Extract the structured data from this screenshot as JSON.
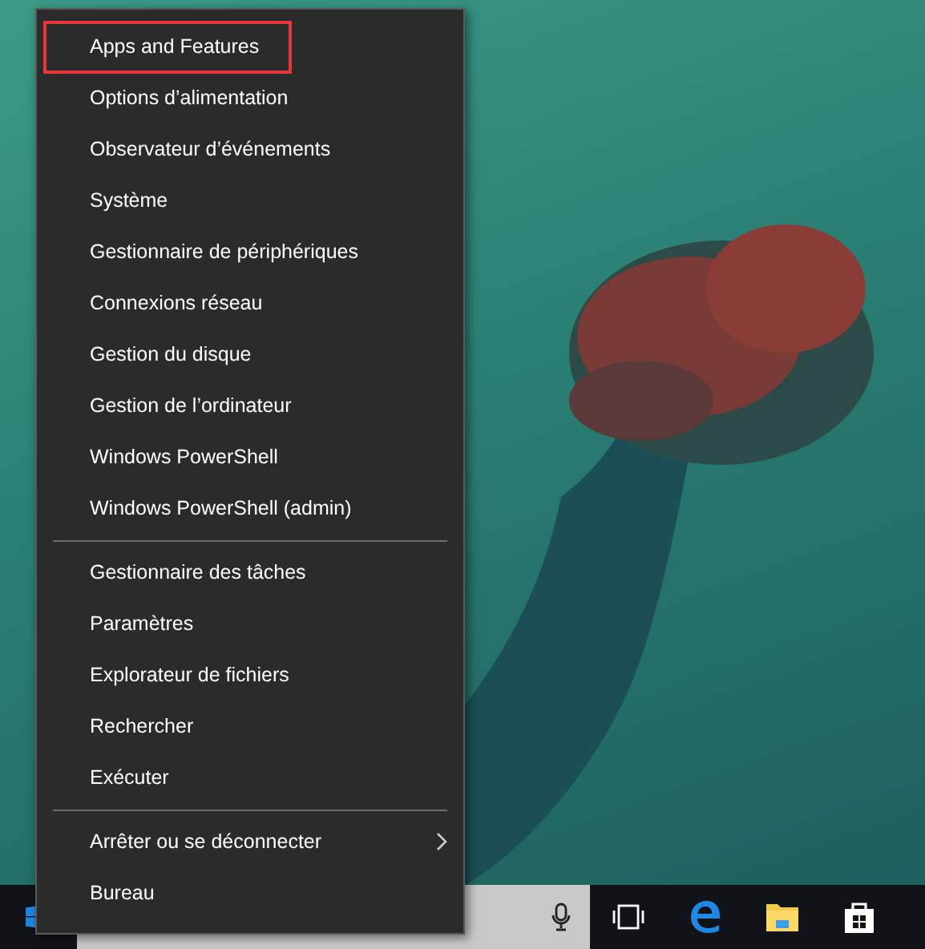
{
  "menu": {
    "groups": [
      {
        "items": [
          {
            "label": "Apps and Features",
            "highlighted": true,
            "submenu": false
          },
          {
            "label": "Options d’alimentation",
            "highlighted": false,
            "submenu": false
          },
          {
            "label": "Observateur d’événements",
            "highlighted": false,
            "submenu": false
          },
          {
            "label": "Système",
            "highlighted": false,
            "submenu": false
          },
          {
            "label": "Gestionnaire de périphériques",
            "highlighted": false,
            "submenu": false
          },
          {
            "label": "Connexions réseau",
            "highlighted": false,
            "submenu": false
          },
          {
            "label": "Gestion du disque",
            "highlighted": false,
            "submenu": false
          },
          {
            "label": "Gestion de l’ordinateur",
            "highlighted": false,
            "submenu": false
          },
          {
            "label": "Windows PowerShell",
            "highlighted": false,
            "submenu": false
          },
          {
            "label": "Windows PowerShell (admin)",
            "highlighted": false,
            "submenu": false
          }
        ]
      },
      {
        "items": [
          {
            "label": "Gestionnaire des tâches",
            "highlighted": false,
            "submenu": false
          },
          {
            "label": "Paramètres",
            "highlighted": false,
            "submenu": false
          },
          {
            "label": "Explorateur de fichiers",
            "highlighted": false,
            "submenu": false
          },
          {
            "label": "Rechercher",
            "highlighted": false,
            "submenu": false
          },
          {
            "label": "Exécuter",
            "highlighted": false,
            "submenu": false
          }
        ]
      },
      {
        "items": [
          {
            "label": "Arrêter ou se déconnecter",
            "highlighted": false,
            "submenu": true
          },
          {
            "label": "Bureau",
            "highlighted": false,
            "submenu": false
          }
        ]
      }
    ]
  }
}
